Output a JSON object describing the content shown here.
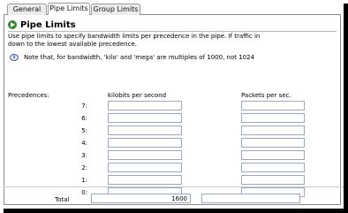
{
  "tabs": [
    {
      "label": "General"
    },
    {
      "label": "Pipe Limits"
    },
    {
      "label": "Group Limits"
    }
  ],
  "section": {
    "title": "Pipe Limits",
    "description_line1": "Use pipe limits to specify bandwidth limits per precedence in the pipe. If traffic in",
    "description_line2": "down to the lowest available precedence.",
    "note": "Note that, for bandwidth, 'kilo' and 'mega' are multiples of 1000, not 1024"
  },
  "table": {
    "precedences_header": "Precedences:",
    "col1_header": "kilobits per second",
    "col2_header": "Packets per sec.",
    "rows": [
      {
        "label": "7:",
        "kbps": "",
        "pps": ""
      },
      {
        "label": "6:",
        "kbps": "",
        "pps": ""
      },
      {
        "label": "5:",
        "kbps": "",
        "pps": ""
      },
      {
        "label": "4:",
        "kbps": "",
        "pps": ""
      },
      {
        "label": "3:",
        "kbps": "",
        "pps": ""
      },
      {
        "label": "2:",
        "kbps": "",
        "pps": ""
      },
      {
        "label": "1:",
        "kbps": "",
        "pps": ""
      },
      {
        "label": "0:",
        "kbps": "",
        "pps": ""
      }
    ],
    "total_label": "Total",
    "total_kbps": "1600",
    "total_pps": ""
  }
}
